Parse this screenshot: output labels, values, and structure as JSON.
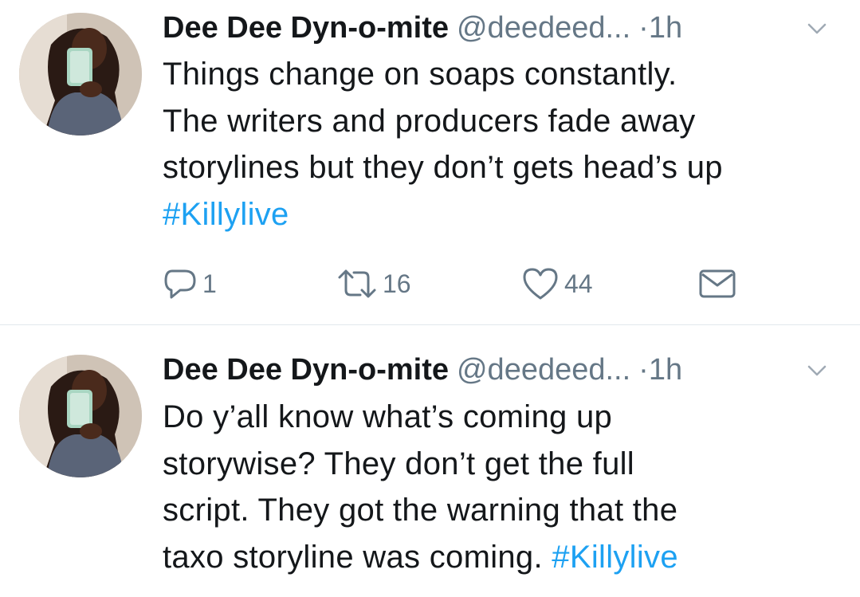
{
  "tweets": [
    {
      "author_name": "Dee Dee Dyn-o-mite",
      "handle": "@deedeed...",
      "dot": "·",
      "time": "1h",
      "text_lines": [
        "Things change on soaps constantly.",
        "The writers and producers fade away",
        "storylines but they don’t gets head’s up"
      ],
      "hashtag": "#Killylive",
      "actions": {
        "reply_icon": "reply-icon",
        "reply_count": "1",
        "retweet_icon": "retweet-icon",
        "retweet_count": "16",
        "like_icon": "heart-icon",
        "like_count": "44",
        "dm_icon": "envelope-icon"
      }
    },
    {
      "author_name": "Dee Dee Dyn-o-mite",
      "handle": "@deedeed...",
      "dot": "·",
      "time": "1h",
      "text_lines": [
        "Do y’all know what’s coming up",
        "storywise?  They don’t get the full",
        "script. They got the warning that the",
        "taxo storyline was coming. "
      ],
      "hashtag": "#Killylive"
    }
  ],
  "colors": {
    "text": "#14171a",
    "secondary": "#657786",
    "link": "#1da1f2",
    "divider": "#e1e8ed"
  }
}
